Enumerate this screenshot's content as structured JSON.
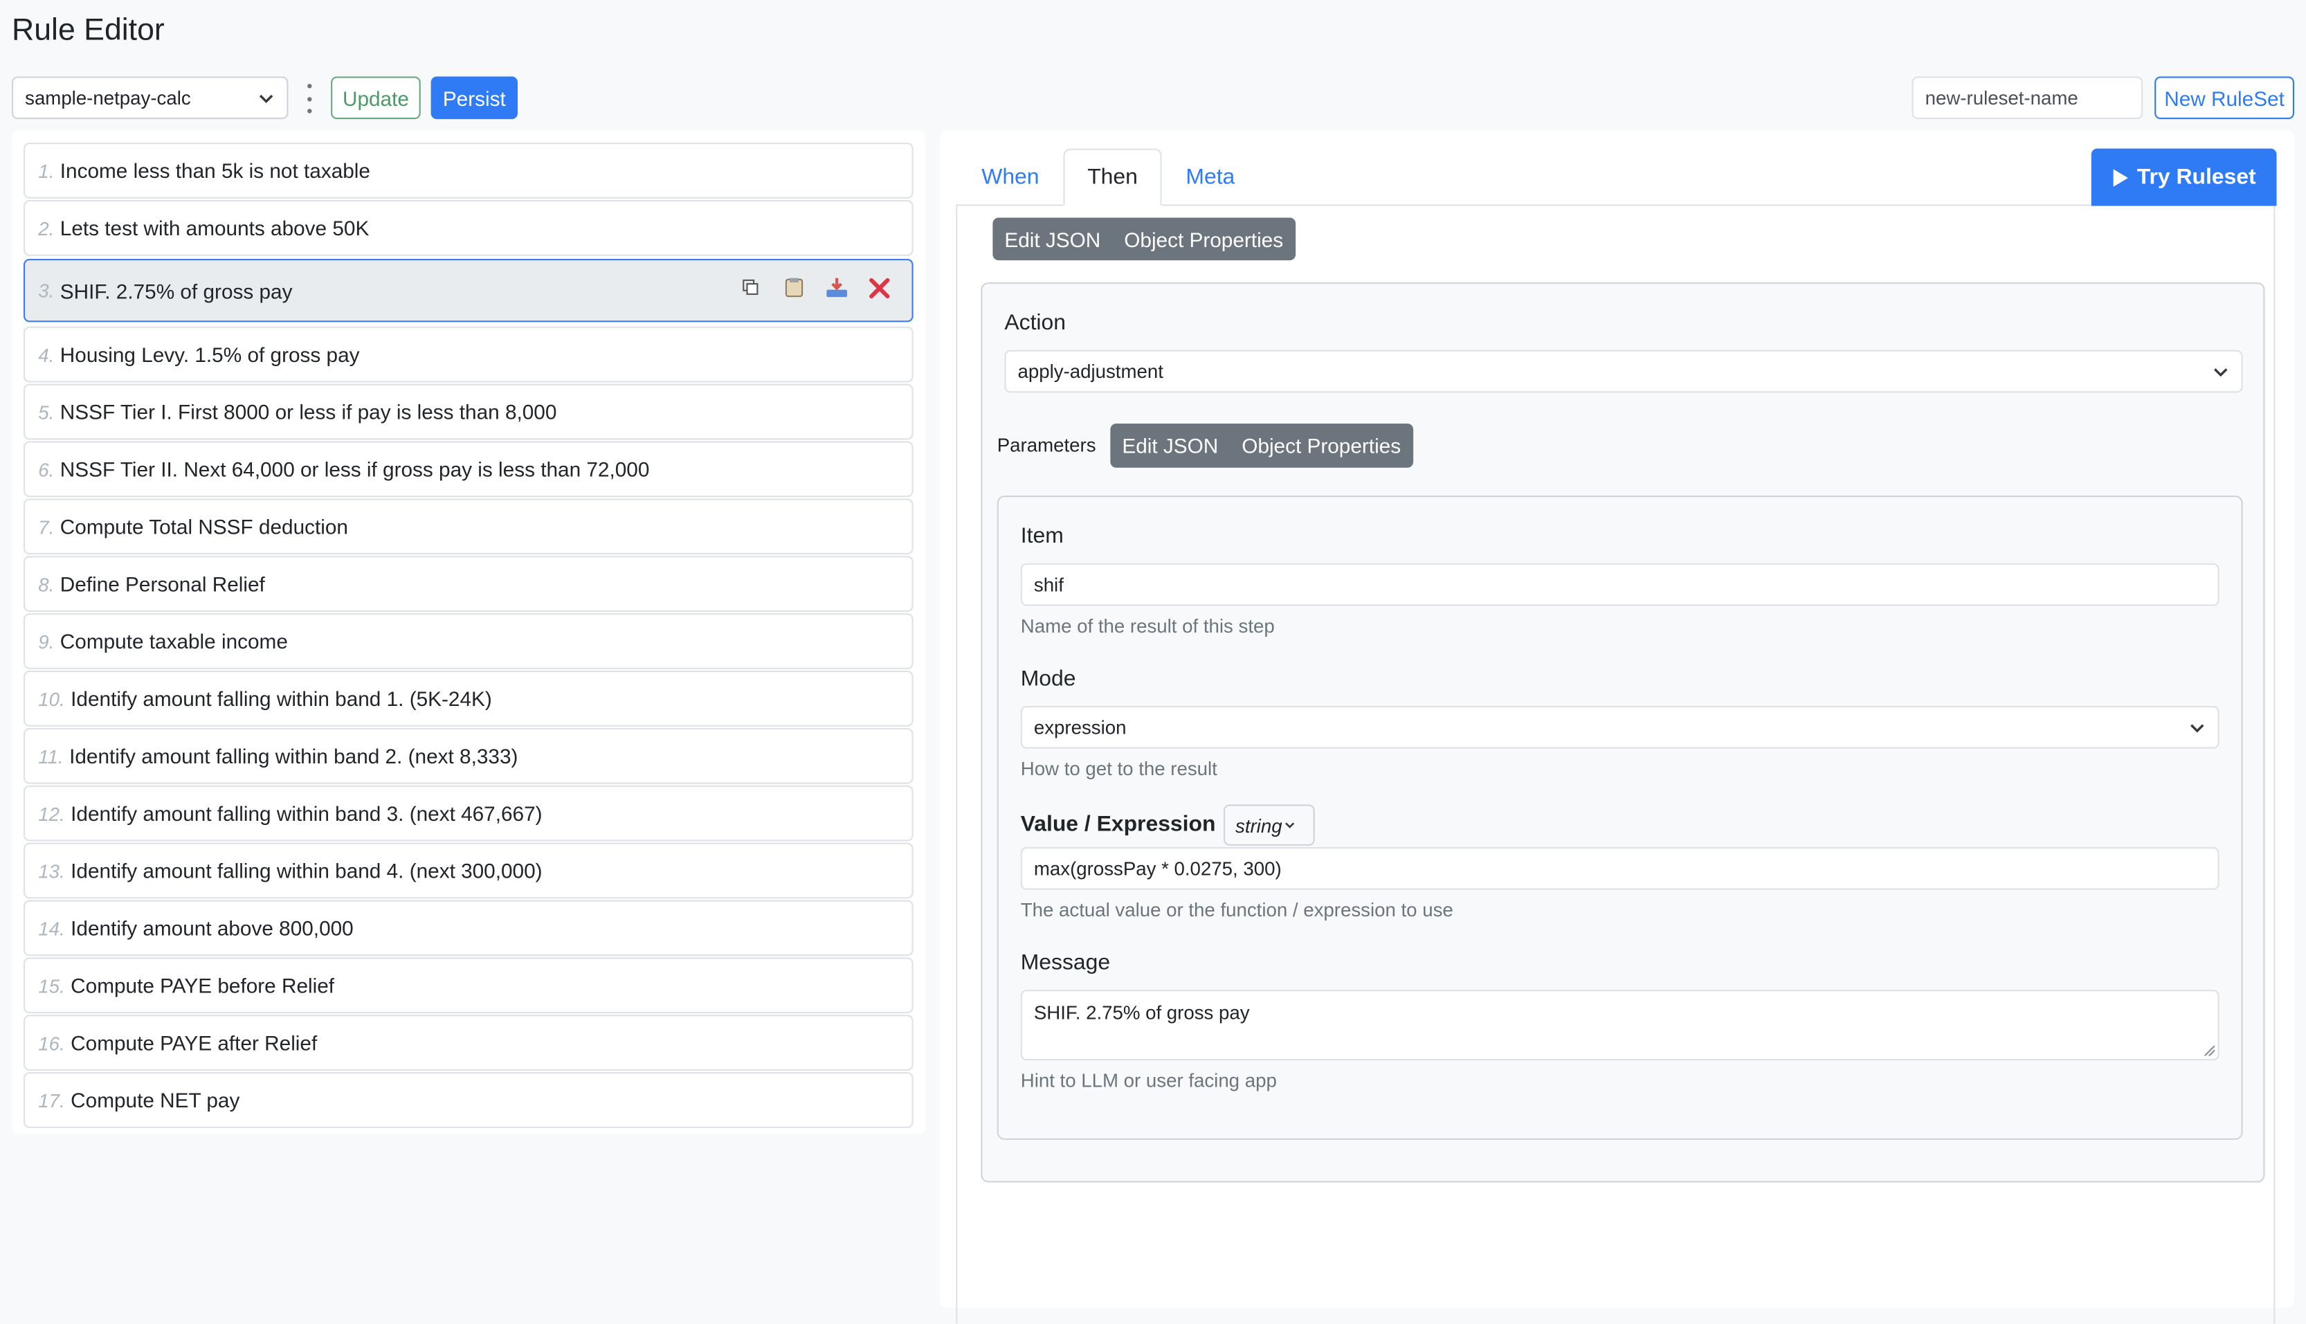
{
  "title": "Rule Editor",
  "toolbar": {
    "ruleset_select": "sample-netpay-calc",
    "update_label": "Update",
    "persist_label": "Persist",
    "new_ruleset_placeholder": "new-ruleset-name",
    "new_ruleset_label": "New RuleSet"
  },
  "rules": [
    {
      "num": "1.",
      "label": "Income less than 5k is not taxable"
    },
    {
      "num": "2.",
      "label": "Lets test with amounts above 50K"
    },
    {
      "num": "3.",
      "label": "SHIF. 2.75% of gross pay"
    },
    {
      "num": "4.",
      "label": "Housing Levy. 1.5% of gross pay"
    },
    {
      "num": "5.",
      "label": "NSSF Tier I. First 8000 or less if pay is less than 8,000"
    },
    {
      "num": "6.",
      "label": "NSSF Tier II. Next 64,000 or less if gross pay is less than 72,000"
    },
    {
      "num": "7.",
      "label": "Compute Total NSSF deduction"
    },
    {
      "num": "8.",
      "label": "Define Personal Relief"
    },
    {
      "num": "9.",
      "label": "Compute taxable income"
    },
    {
      "num": "10.",
      "label": "Identify amount falling within band 1. (5K-24K)"
    },
    {
      "num": "11.",
      "label": "Identify amount falling within band 2. (next 8,333)"
    },
    {
      "num": "12.",
      "label": "Identify amount falling within band 3. (next 467,667)"
    },
    {
      "num": "13.",
      "label": "Identify amount falling within band 4. (next 300,000)"
    },
    {
      "num": "14.",
      "label": "Identify amount above 800,000"
    },
    {
      "num": "15.",
      "label": "Compute PAYE before Relief"
    },
    {
      "num": "16.",
      "label": "Compute PAYE after Relief"
    },
    {
      "num": "17.",
      "label": "Compute NET pay"
    }
  ],
  "active_rule_index": 2,
  "tabs": {
    "when": "When",
    "then": "Then",
    "meta": "Meta"
  },
  "try_label": "Try Ruleset",
  "then": {
    "edit_json": "Edit JSON",
    "object_properties": "Object Properties",
    "action_label": "Action",
    "action_value": "apply-adjustment",
    "parameters_label": "Parameters",
    "item_label": "Item",
    "item_value": "shif",
    "item_help": "Name of the result of this step",
    "mode_label": "Mode",
    "mode_value": "expression",
    "mode_help": "How to get to the result",
    "value_label": "Value / Expression",
    "value_type": "string",
    "value_value": "max(grossPay * 0.0275, 300)",
    "value_help": "The actual value or the function / expression to use",
    "message_label": "Message",
    "message_value": "SHIF. 2.75% of gross pay",
    "message_help": "Hint to LLM or user facing app"
  },
  "colors": {
    "primary": "#2f7bf5",
    "danger": "#dc3545",
    "success": "#4a9a67",
    "secondary": "#6c757d"
  }
}
